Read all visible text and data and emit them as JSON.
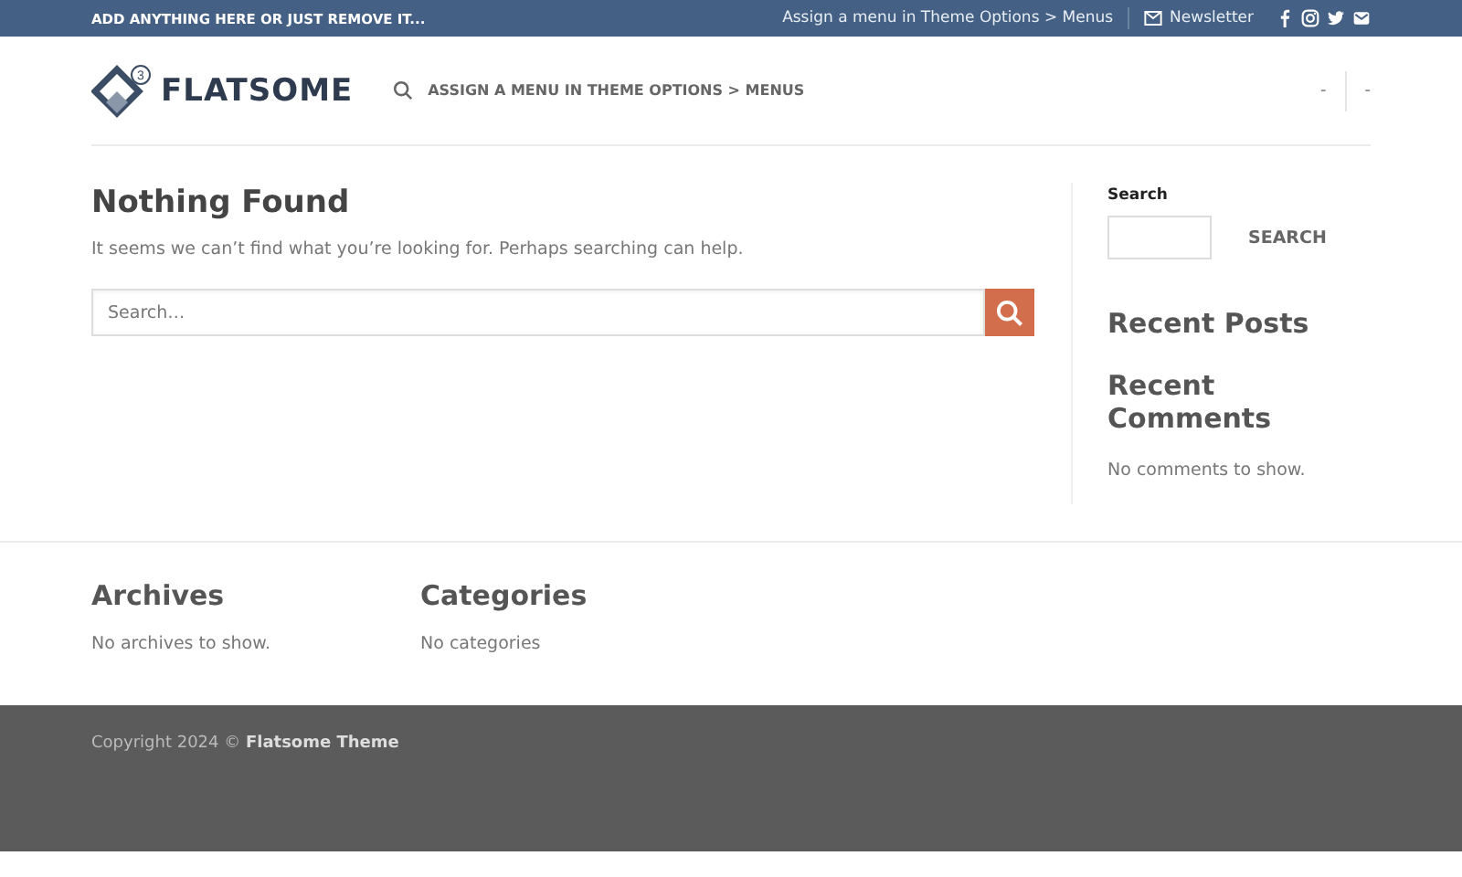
{
  "top_bar": {
    "text": "ADD ANYTHING HERE OR JUST REMOVE IT...",
    "menu_link": "Assign a menu in Theme Options > Menus",
    "newsletter": "Newsletter",
    "social": [
      {
        "kind": "facebook"
      },
      {
        "kind": "instagram"
      },
      {
        "kind": "twitter"
      },
      {
        "kind": "email"
      }
    ]
  },
  "header": {
    "logo": "FLATSOME",
    "logo_badge": "3",
    "nav_link": "ASSIGN A MENU IN THEME OPTIONS > MENUS",
    "right_items": [
      "-",
      "-"
    ]
  },
  "main": {
    "title": "Nothing Found",
    "message": "It seems we can’t find what you’re looking for. Perhaps searching can help.",
    "search": {
      "placeholder": "Search…"
    }
  },
  "sidebar": {
    "search_label": "Search",
    "search_button": "SEARCH",
    "widgets": [
      {
        "title": "Recent Posts"
      },
      {
        "title": "Recent Comments",
        "text": "No comments to show."
      }
    ]
  },
  "footer_widgets": [
    {
      "title": "Archives",
      "text": "No archives to show."
    },
    {
      "title": "Categories",
      "text": "No categories"
    }
  ],
  "copyright": "Copyright 2024 © **Flatsome Theme**"
}
